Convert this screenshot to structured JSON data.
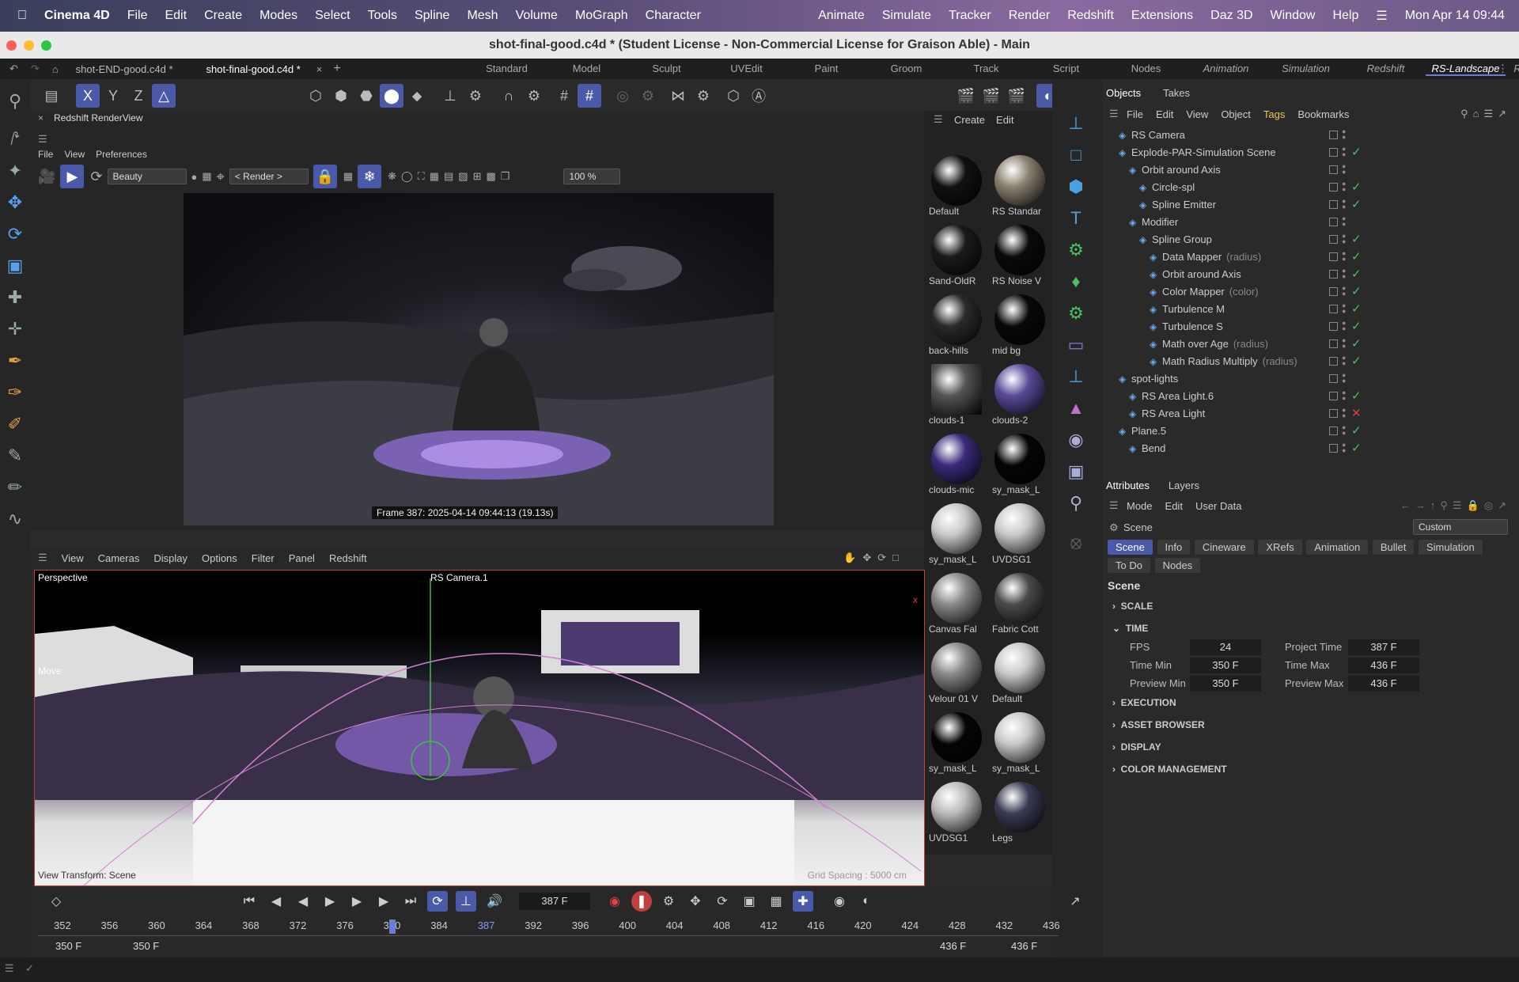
{
  "menubar": {
    "app": "Cinema 4D",
    "items": [
      "File",
      "Edit",
      "Create",
      "Modes",
      "Select",
      "Tools",
      "Spline",
      "Mesh",
      "Volume",
      "MoGraph",
      "Character"
    ],
    "right_items": [
      "Animate",
      "Simulate",
      "Tracker",
      "Render",
      "Redshift",
      "Extensions",
      "Daz 3D",
      "Window",
      "Help"
    ],
    "clock": "Mon Apr 14  09:44"
  },
  "window": {
    "title": "shot-final-good.c4d * (Student License - Non-Commercial License for Graison Able) - Main"
  },
  "tabs": {
    "doc1": "shot-END-good.c4d *",
    "doc2": "shot-final-good.c4d *"
  },
  "layouts": [
    "Standard",
    "Model",
    "Sculpt",
    "UVEdit",
    "Paint",
    "Groom",
    "Track",
    "Script",
    "Nodes",
    "Animation",
    "Simulation",
    "Redshift",
    "RS-Landscape",
    "RS Undocked"
  ],
  "renderview": {
    "title": "Redshift RenderView",
    "menu": [
      "File",
      "View",
      "Preferences"
    ],
    "aov": "Beauty",
    "camera": "< Render >",
    "zoom": "100 %",
    "stamp": "Frame  387:  2025-04-14  09:44:13  (19.13s)"
  },
  "materials": {
    "menu": [
      "Create",
      "Edit"
    ],
    "items": [
      {
        "name": "Default",
        "color": "#111"
      },
      {
        "name": "RS Standar",
        "color": "#8a8070"
      },
      {
        "name": "Sand-OldR",
        "color": "#1a1a1a"
      },
      {
        "name": "RS Noise V",
        "color": "#0a0a0a"
      },
      {
        "name": "back-hills",
        "color": "#2a2a2a"
      },
      {
        "name": "mid bg",
        "color": "#080808"
      },
      {
        "name": "clouds-1",
        "color": "#555"
      },
      {
        "name": "clouds-2",
        "color": "#5a4a9a"
      },
      {
        "name": "clouds-mic",
        "color": "#3a2a7a"
      },
      {
        "name": "sy_mask_L",
        "color": "#050505"
      },
      {
        "name": "sy_mask_L",
        "color": "#c8c8c8"
      },
      {
        "name": "UVDSG1",
        "color": "#c8c8c8"
      },
      {
        "name": "Canvas Fal",
        "color": "#888"
      },
      {
        "name": "Fabric Cott",
        "color": "#4a4a4a"
      },
      {
        "name": "Velour 01 V",
        "color": "#888"
      },
      {
        "name": "Default",
        "color": "#c8c8c8"
      },
      {
        "name": "sy_mask_L",
        "color": "#050505"
      },
      {
        "name": "sy_mask_L",
        "color": "#c8c8c8"
      },
      {
        "name": "UVDSG1",
        "color": "#bbb"
      },
      {
        "name": "Legs",
        "color": "#3a3a55"
      }
    ]
  },
  "viewport": {
    "menu": [
      "View",
      "Cameras",
      "Display",
      "Options",
      "Filter",
      "Panel",
      "Redshift"
    ],
    "label": "Perspective",
    "camera_label": "RS Camera.1",
    "move": "Move",
    "transform": "View Transform: Scene",
    "grid": "Grid Spacing : 5000 cm"
  },
  "timeline": {
    "current_frame": "387 F",
    "ticks": [
      "352",
      "356",
      "360",
      "364",
      "368",
      "372",
      "376",
      "380",
      "384",
      "387",
      "392",
      "396",
      "400",
      "404",
      "408",
      "412",
      "416",
      "420",
      "424",
      "428",
      "432",
      "436"
    ],
    "range_start": "350 F",
    "range_start2": "350 F",
    "range_end": "436 F",
    "range_end2": "436 F"
  },
  "objects": {
    "tabs": [
      "Objects",
      "Takes"
    ],
    "menu": [
      "File",
      "Edit",
      "View",
      "Object",
      "Tags",
      "Bookmarks"
    ],
    "rows": [
      {
        "name": "RS Camera",
        "sub": "",
        "indent": 0,
        "state": ""
      },
      {
        "name": "Explode-PAR-Simulation Scene",
        "sub": "",
        "indent": 0,
        "state": "check"
      },
      {
        "name": "Orbit around Axis",
        "sub": "",
        "indent": 1,
        "state": ""
      },
      {
        "name": "Circle-spl",
        "sub": "",
        "indent": 2,
        "state": "check"
      },
      {
        "name": "Spline Emitter",
        "sub": "",
        "indent": 2,
        "state": "check"
      },
      {
        "name": "Modifier",
        "sub": "",
        "indent": 1,
        "state": ""
      },
      {
        "name": "Spline Group",
        "sub": "",
        "indent": 2,
        "state": "check"
      },
      {
        "name": "Data Mapper",
        "sub": "(radius)",
        "indent": 3,
        "state": "check"
      },
      {
        "name": "Orbit around Axis",
        "sub": "",
        "indent": 3,
        "state": "check"
      },
      {
        "name": "Color Mapper",
        "sub": "(color)",
        "indent": 3,
        "state": "check"
      },
      {
        "name": "Turbulence M",
        "sub": "",
        "indent": 3,
        "state": "check"
      },
      {
        "name": "Turbulence S",
        "sub": "",
        "indent": 3,
        "state": "check"
      },
      {
        "name": "Math over Age",
        "sub": "(radius)",
        "indent": 3,
        "state": "check"
      },
      {
        "name": "Math Radius Multiply",
        "sub": "(radius)",
        "indent": 3,
        "state": "check"
      },
      {
        "name": "spot-lights",
        "sub": "",
        "indent": 0,
        "state": ""
      },
      {
        "name": "RS Area Light.6",
        "sub": "",
        "indent": 1,
        "state": "check"
      },
      {
        "name": "RS Area Light",
        "sub": "",
        "indent": 1,
        "state": "x"
      },
      {
        "name": "Plane.5",
        "sub": "",
        "indent": 0,
        "state": "check"
      },
      {
        "name": "Bend",
        "sub": "",
        "indent": 1,
        "state": "check"
      }
    ]
  },
  "attributes": {
    "tabs": [
      "Attributes",
      "Layers"
    ],
    "menu": [
      "Mode",
      "Edit",
      "User Data"
    ],
    "object": "Scene",
    "preset": "Custom",
    "pills": [
      "Scene",
      "Info",
      "Cineware",
      "XRefs",
      "Animation",
      "Bullet",
      "Simulation",
      "To Do",
      "Nodes"
    ],
    "heading": "Scene",
    "sections": [
      "SCALE",
      "TIME",
      "EXECUTION",
      "ASSET BROWSER",
      "DISPLAY",
      "COLOR MANAGEMENT"
    ],
    "time": {
      "fps_label": "FPS",
      "fps": "24",
      "project_time_label": "Project Time",
      "project_time": "387 F",
      "time_min_label": "Time Min",
      "time_min": "350 F",
      "time_max_label": "Time Max",
      "time_max": "436 F",
      "preview_min_label": "Preview Min",
      "preview_min": "350 F",
      "preview_max_label": "Preview Max",
      "preview_max": "436 F"
    }
  }
}
